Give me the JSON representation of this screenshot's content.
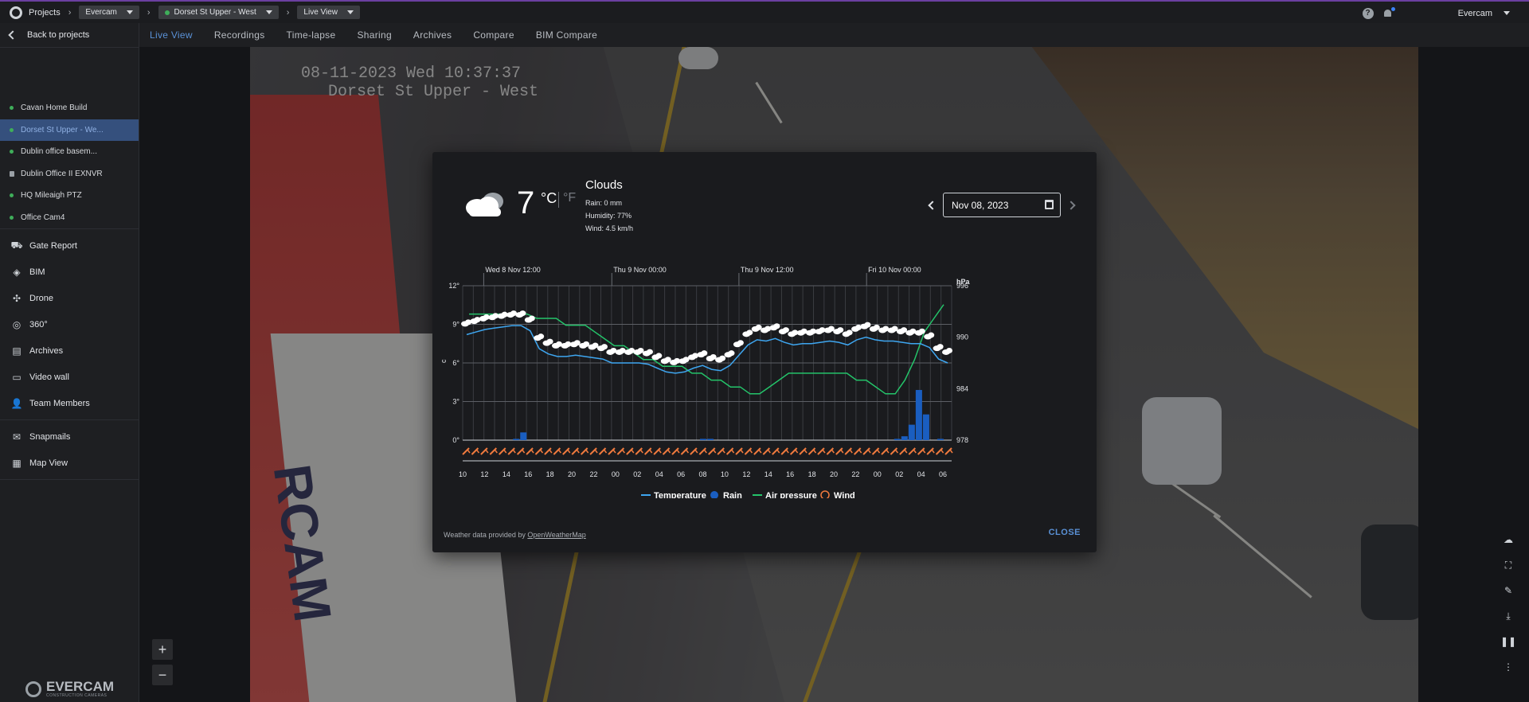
{
  "topbar": {
    "projects_label": "Projects",
    "company_select": "Evercam",
    "camera_select": "Dorset St Upper - West",
    "view_select": "Live View",
    "help_icon": "?",
    "user_name": "Evercam"
  },
  "sidebar": {
    "back_label": "Back to projects",
    "cameras": [
      {
        "label": "Cavan Home Build",
        "status": "online"
      },
      {
        "label": "Dorset St Upper - We...",
        "status": "online",
        "active": true
      },
      {
        "label": "Dublin office basem...",
        "status": "online"
      },
      {
        "label": "Dublin Office II EXNVR",
        "status": "locked"
      },
      {
        "label": "HQ Mileaigh PTZ",
        "status": "online"
      },
      {
        "label": "Office Cam4",
        "status": "online"
      }
    ],
    "menu": [
      {
        "label": "Gate Report",
        "icon": "truck-icon"
      },
      {
        "label": "BIM",
        "icon": "bim-icon"
      },
      {
        "label": "Drone",
        "icon": "drone-icon"
      },
      {
        "label": "360°",
        "icon": "360-icon"
      },
      {
        "label": "Archives",
        "icon": "archive-icon"
      },
      {
        "label": "Video wall",
        "icon": "monitor-icon"
      },
      {
        "label": "Team Members",
        "icon": "add-user-icon"
      },
      {
        "label": "Snapmails",
        "icon": "mail-icon"
      },
      {
        "label": "Map View",
        "icon": "map-icon"
      }
    ],
    "brand_name": "EVERCAM",
    "brand_sub": "CONSTRUCTION CAMERAS"
  },
  "tabs": [
    "Live View",
    "Recordings",
    "Time-lapse",
    "Sharing",
    "Archives",
    "Compare",
    "BIM Compare"
  ],
  "camera": {
    "timestamp": "08-11-2023 Wed 10:37:37",
    "camera_label": "Dorset St Upper - West",
    "banner_text": "RCAM"
  },
  "zoom": {
    "in": "+",
    "out": "−"
  },
  "colors": {
    "accent": "#5a91d6",
    "temperature": "#3ea6f0",
    "rain": "#1a5ec0",
    "pressure": "#24c46a",
    "wind": "#f07a3e"
  },
  "weather": {
    "temp_value": "7",
    "unit_c": "°C",
    "unit_f": "°F",
    "condition": "Clouds",
    "rain": "Rain: 0 mm",
    "humidity": "Humidity: 77%",
    "wind": "Wind: 4.5 km/h",
    "date": "Nov 08, 2023",
    "provided_prefix": "Weather data provided by ",
    "provided_link": "OpenWeatherMap",
    "close_label": "CLOSE"
  },
  "chart_data": {
    "type": "line",
    "date_labels": [
      "Wed 8 Nov 12:00",
      "Thu 9 Nov 00:00",
      "Thu 9 Nov 12:00",
      "Fri 10 Nov 00:00"
    ],
    "x_ticks": [
      "10",
      "12",
      "14",
      "16",
      "18",
      "20",
      "22",
      "00",
      "02",
      "04",
      "06",
      "08",
      "10",
      "12",
      "14",
      "16",
      "18",
      "20",
      "22",
      "00",
      "02",
      "04",
      "06"
    ],
    "y_left_ticks": [
      "12°",
      "9°",
      "6°",
      "3°",
      "0°"
    ],
    "y_left_label": "c",
    "y_right_ticks": [
      "996",
      "990",
      "984",
      "978"
    ],
    "y_right_label": "hPa",
    "ylim_left": [
      0,
      12
    ],
    "ylim_right": [
      978,
      996
    ],
    "legend": [
      "Temperature",
      "Rain",
      "Air pressure",
      "Wind"
    ],
    "series": [
      {
        "name": "Temperature",
        "values": [
          8.2,
          8.4,
          8.6,
          8.7,
          8.8,
          8.9,
          8.9,
          8.5,
          7.1,
          6.7,
          6.5,
          6.5,
          6.6,
          6.5,
          6.4,
          6.3,
          6.0,
          6.0,
          6.0,
          6.0,
          5.9,
          5.6,
          5.3,
          5.2,
          5.3,
          5.6,
          5.8,
          5.5,
          5.4,
          5.8,
          6.6,
          7.4,
          7.8,
          7.7,
          7.9,
          7.6,
          7.4,
          7.5,
          7.5,
          7.6,
          7.7,
          7.6,
          7.4,
          7.8,
          8.0,
          7.8,
          7.7,
          7.7,
          7.6,
          7.5,
          7.5,
          7.2,
          6.3,
          6.0
        ]
      },
      {
        "name": "Rain",
        "values": [
          0,
          0,
          0,
          0,
          0,
          0,
          0,
          0.1,
          0.6,
          0,
          0,
          0,
          0,
          0,
          0,
          0,
          0,
          0,
          0,
          0,
          0,
          0,
          0,
          0,
          0,
          0,
          0,
          0,
          0,
          0,
          0,
          0,
          0,
          0.1,
          0.1,
          0,
          0,
          0,
          0,
          0,
          0,
          0,
          0,
          0,
          0,
          0,
          0,
          0,
          0,
          0,
          0,
          0,
          0,
          0,
          0,
          0,
          0,
          0,
          0,
          0,
          0.1,
          0.3,
          1.2,
          3.9,
          2.0,
          0,
          0.1,
          0
        ]
      },
      {
        "name": "Air pressure",
        "values": [
          992.7,
          992.7,
          992.7,
          992.7,
          992.7,
          992.7,
          992.7,
          992.2,
          992.2,
          992.2,
          991.4,
          991.4,
          991.4,
          990.6,
          989.8,
          989.0,
          989.0,
          988.2,
          987.4,
          987.4,
          986.6,
          986.6,
          986.6,
          985.8,
          985.8,
          985.0,
          985.0,
          984.2,
          984.2,
          983.4,
          983.4,
          984.2,
          985.0,
          985.8,
          985.8,
          985.8,
          985.8,
          985.8,
          985.8,
          985.8,
          985.0,
          985.0,
          984.2,
          983.4,
          983.4,
          985.0,
          987.4,
          990.6,
          992.2,
          993.8
        ]
      },
      {
        "name": "Wind",
        "values": [
          4.5,
          4.5,
          4.5,
          4.5,
          4.5,
          4.5,
          4.5,
          4.5,
          4.5,
          4.5,
          4.5,
          4.5,
          4.5,
          4.5,
          4.5,
          4.5,
          4.5,
          4.5,
          4.5,
          4.5,
          4.5,
          4.5,
          4.5,
          4.5,
          4.5,
          4.5,
          4.5,
          4.5,
          4.5,
          4.5,
          4.5,
          4.5,
          4.5,
          4.5,
          4.5,
          4.5,
          4.5,
          4.5,
          4.5,
          4.5,
          4.5,
          4.5,
          4.5,
          4.5,
          4.5,
          4.5,
          4.5,
          4.5,
          4.5,
          4.5,
          4.5,
          4.5,
          4.5,
          4.5
        ]
      }
    ],
    "grid": true,
    "legend_position": "bottom"
  }
}
